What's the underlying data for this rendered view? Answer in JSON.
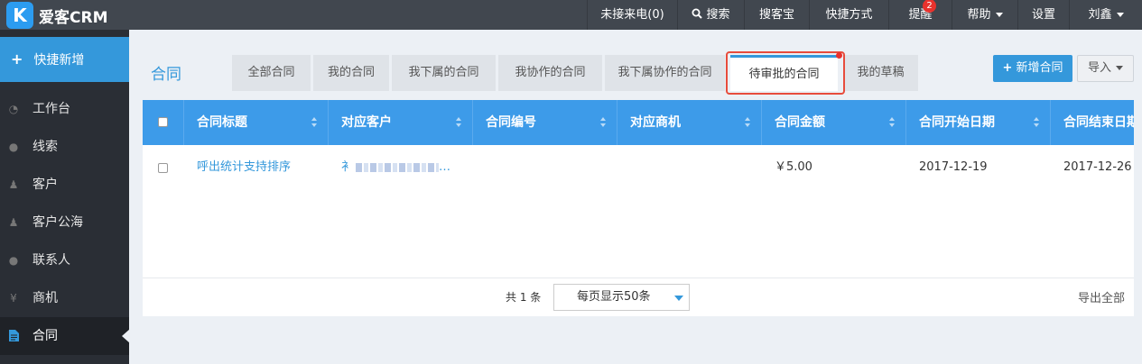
{
  "app": {
    "logo_letter": "K",
    "name": "爱客CRM"
  },
  "topnav": {
    "missed_calls": "未接来电(0)",
    "search": "搜索",
    "sokebao": "搜客宝",
    "shortcuts": "快捷方式",
    "reminder": "提醒",
    "reminder_badge": "2",
    "help": "帮助",
    "settings": "设置",
    "user": "刘鑫"
  },
  "sidebar": {
    "quick_add": "快捷新增",
    "items": [
      {
        "label": "工作台",
        "icon": "dashboard-icon"
      },
      {
        "label": "线索",
        "icon": "globe-icon"
      },
      {
        "label": "客户",
        "icon": "users-icon"
      },
      {
        "label": "客户公海",
        "icon": "users-icon"
      },
      {
        "label": "联系人",
        "icon": "chat-icon"
      },
      {
        "label": "商机",
        "icon": "yen-icon"
      },
      {
        "label": "合同",
        "icon": "document-icon",
        "active": true
      }
    ]
  },
  "page": {
    "title": "合同"
  },
  "tabs": [
    {
      "label": "全部合同"
    },
    {
      "label": "我的合同"
    },
    {
      "label": "我下属的合同"
    },
    {
      "label": "我协作的合同"
    },
    {
      "label": "我下属协作的合同"
    },
    {
      "label": "待审批的合同",
      "active": true
    },
    {
      "label": "我的草稿"
    }
  ],
  "actions": {
    "add": "新增合同",
    "import": "导入"
  },
  "table": {
    "columns": [
      "合同标题",
      "对应客户",
      "合同编号",
      "对应商机",
      "合同金额",
      "合同开始日期",
      "合同结束日期"
    ],
    "rows": [
      {
        "title": "呼出统计支持排序",
        "customer_prefix": "衤",
        "customer_suffix": "…",
        "number": "",
        "opportunity": "",
        "amount": "￥5.00",
        "start": "2017-12-19",
        "end": "2017-12-26"
      }
    ]
  },
  "footer": {
    "total": "共 1 条",
    "page_size": "每页显示50条",
    "export_all": "导出全部"
  },
  "colors": {
    "accent": "#3498db",
    "topbar": "#41474f",
    "sidebar": "#2a2e35",
    "highlight": "#e74c3c"
  }
}
